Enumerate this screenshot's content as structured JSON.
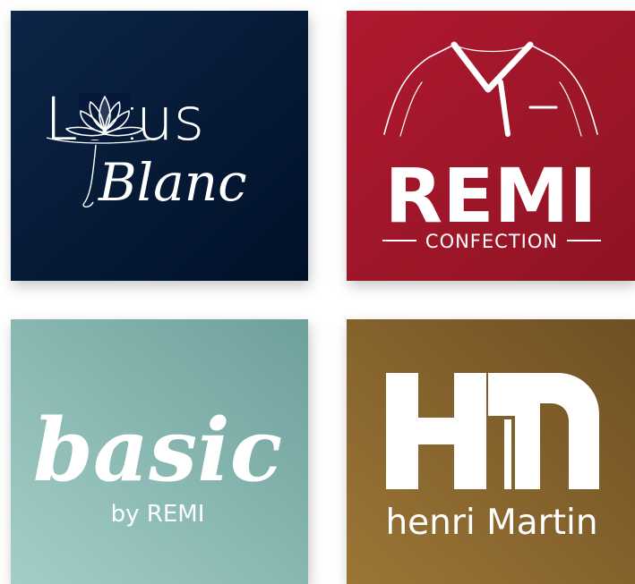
{
  "colors": {
    "lotus_bg_a": "#0d2547",
    "lotus_bg_b": "#001128",
    "remi_bg_a": "#b01830",
    "remi_bg_b": "#8e1423",
    "basic_bg_a": "#a3cec7",
    "basic_bg_b": "#6ea09b",
    "henri_bg_a": "#9b7635",
    "henri_bg_b": "#6f4f24",
    "logo": "#ffffff"
  },
  "tiles": {
    "lotus": {
      "logo_main": "Lotus",
      "logo_script": "Blanc",
      "icon": "lotus-flower-icon"
    },
    "remi": {
      "logo_main": "REMI",
      "logo_sub": "CONFECTION",
      "icon": "shirt-icon"
    },
    "basic": {
      "logo_main": "basic",
      "logo_sub": "by REMI"
    },
    "henri": {
      "monogram": "HM",
      "logo_main": "henri Martin"
    }
  }
}
